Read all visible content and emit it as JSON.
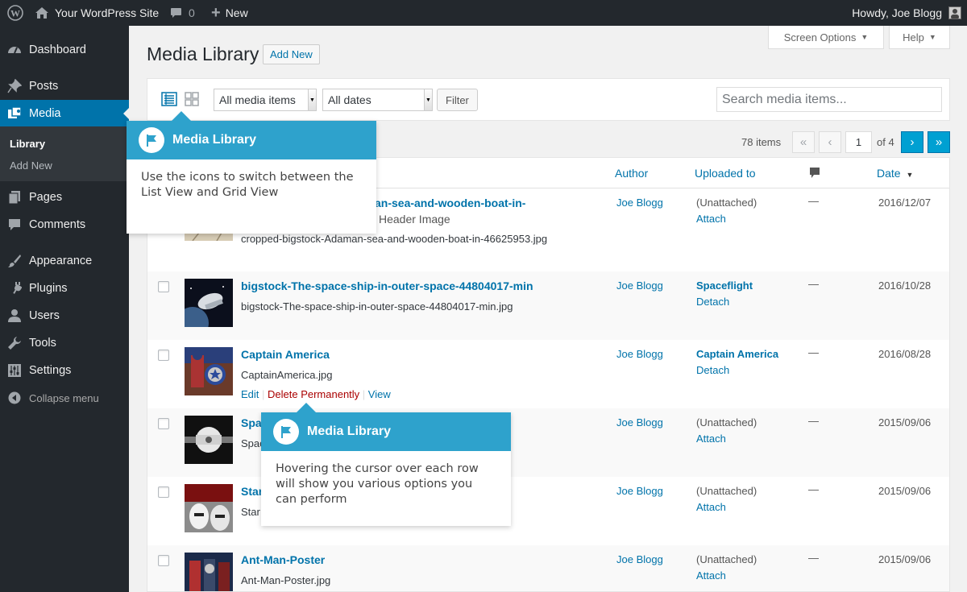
{
  "admin_bar": {
    "site_name": "Your WordPress Site",
    "comments_count": "0",
    "new_label": "New",
    "greeting": "Howdy, Joe Blogg"
  },
  "sidebar": {
    "items": [
      {
        "label": "Dashboard",
        "icon": "dashboard-icon"
      },
      {
        "label": "Posts",
        "icon": "pin-icon"
      },
      {
        "label": "Media",
        "icon": "media-icon"
      },
      {
        "label": "Pages",
        "icon": "pages-icon"
      },
      {
        "label": "Comments",
        "icon": "comment-icon"
      },
      {
        "label": "Appearance",
        "icon": "brush-icon"
      },
      {
        "label": "Plugins",
        "icon": "plug-icon"
      },
      {
        "label": "Users",
        "icon": "user-icon"
      },
      {
        "label": "Tools",
        "icon": "wrench-icon"
      },
      {
        "label": "Settings",
        "icon": "sliders-icon"
      }
    ],
    "submenu": [
      "Library",
      "Add New"
    ],
    "collapse_label": "Collapse menu"
  },
  "header": {
    "title": "Media Library",
    "add_new": "Add New",
    "screen_options": "Screen Options",
    "help": "Help"
  },
  "filters": {
    "media_type": "All media items",
    "dates": "All dates",
    "filter_button": "Filter",
    "search_placeholder": "Search media items..."
  },
  "pagination": {
    "items": "78 items",
    "first": "«",
    "prev": "‹",
    "current": "1",
    "of": "of 4",
    "next": "›",
    "last": "»"
  },
  "table": {
    "columns": {
      "author": "Author",
      "uploaded_to": "Uploaded to",
      "date": "Date"
    },
    "rows": [
      {
        "title_line1": "an-sea-and-wooden-boat-in-",
        "title_line2": "Header Image",
        "file": "cropped-bigstock-Adaman-sea-and-wooden-boat-in-46625953.jpg",
        "author": "Joe Blogg",
        "uploaded_to": "(Unattached)",
        "action": "Attach",
        "comments": "—",
        "date": "2016/12/07"
      },
      {
        "title": "bigstock-The-space-ship-in-outer-space-44804017-min",
        "file": "bigstock-The-space-ship-in-outer-space-44804017-min.jpg",
        "author": "Joe Blogg",
        "uploaded_to": "Spaceflight",
        "action": "Detach",
        "comments": "—",
        "date": "2016/10/28"
      },
      {
        "title": "Captain America",
        "file": "CaptainAmerica.jpg",
        "author": "Joe Blogg",
        "uploaded_to": "Captain America",
        "action": "Detach",
        "comments": "—",
        "date": "2016/08/28",
        "row_actions": {
          "edit": "Edit",
          "delete": "Delete Permanently",
          "view": "View"
        }
      },
      {
        "title": "Spa",
        "file": "Spac",
        "author": "Joe Blogg",
        "uploaded_to": "(Unattached)",
        "action": "Attach",
        "comments": "—",
        "date": "2015/09/06"
      },
      {
        "title": "Star",
        "file": "Star",
        "author": "Joe Blogg",
        "uploaded_to": "(Unattached)",
        "action": "Attach",
        "comments": "—",
        "date": "2015/09/06"
      },
      {
        "title": "Ant-Man-Poster",
        "file": "Ant-Man-Poster.jpg",
        "author": "Joe Blogg",
        "uploaded_to": "(Unattached)",
        "action": "Attach",
        "comments": "—",
        "date": "2015/09/06"
      }
    ]
  },
  "pointers": [
    {
      "title": "Media Library",
      "body": "Use the icons to switch between the List View and Grid View"
    },
    {
      "title": "Media Library",
      "body": "Hovering the cursor over each row will show you various options you can perform"
    }
  ],
  "colors": {
    "accent": "#0073aa",
    "pointer": "#2ea2cc",
    "delete": "#a00",
    "adminbar": "#23282d"
  }
}
